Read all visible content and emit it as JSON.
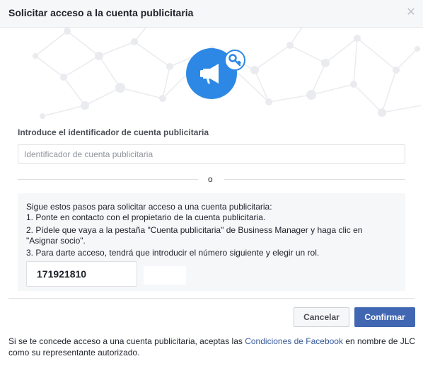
{
  "dialog": {
    "title": "Solicitar acceso a la cuenta publicitaria",
    "close_icon": "close-icon"
  },
  "hero": {
    "main_icon": "megaphone-icon",
    "badge_icon": "key-icon",
    "colors": {
      "accent": "#2d88e5",
      "network": "#e9ebee"
    }
  },
  "form": {
    "label": "Introduce el identificador de cuenta publicitaria",
    "placeholder": "Identificador de cuenta publicitaria",
    "value": ""
  },
  "divider": {
    "text": "o"
  },
  "steps": {
    "intro": "Sigue estos pasos para solicitar acceso a una cuenta publicitaria:",
    "step1": "1. Ponte en contacto con el propietario de la cuenta publicitaria.",
    "step2a": "2. Pídele que vaya a la pestaña \"Cuenta publicitaria\" de Business Manager y haga clic en",
    "step2b": "\"Asignar socio\".",
    "step3": "3. Para darte acceso, tendrá que introducir el número siguiente y elegir un rol.",
    "business_id": "171921810"
  },
  "buttons": {
    "cancel": "Cancelar",
    "confirm": "Confirmar"
  },
  "legal": {
    "before": "Si se te concede acceso a una cuenta publicitaria, aceptas las ",
    "link": "Condiciones de Facebook",
    "after": " en nombre de JLC como su representante autorizado."
  }
}
